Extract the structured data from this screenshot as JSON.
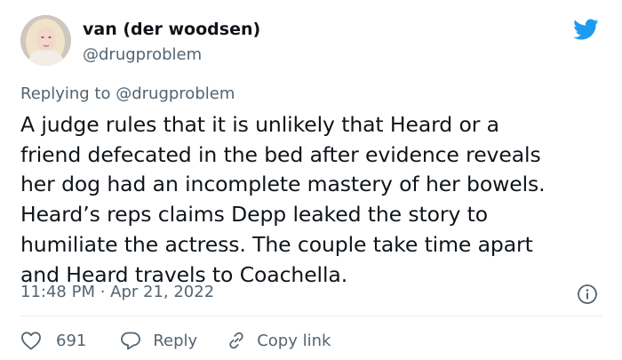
{
  "author": {
    "display_name": "van (der woodsen)",
    "handle": "@drugproblem",
    "avatar_icon": "profile-photo"
  },
  "logo_icon": "twitter-bird-icon",
  "brand_color": "#1d9bf0",
  "replying_to": {
    "prefix": "Replying to",
    "mention": "@drugproblem"
  },
  "tweet": {
    "lines": [
      "A judge rules that it is unlikely that Heard or a",
      "friend defecated in the bed after evidence reveals",
      "her dog had an incomplete mastery of her bowels.",
      "Heard’s reps claims Depp leaked the story to",
      "humiliate the actress. The couple take time apart",
      "and Heard travels to Coachella."
    ],
    "timestamp": "11:48 PM · Apr 21, 2022"
  },
  "actions": {
    "like_count": "691",
    "reply_label": "Reply",
    "copy_link_label": "Copy link"
  }
}
